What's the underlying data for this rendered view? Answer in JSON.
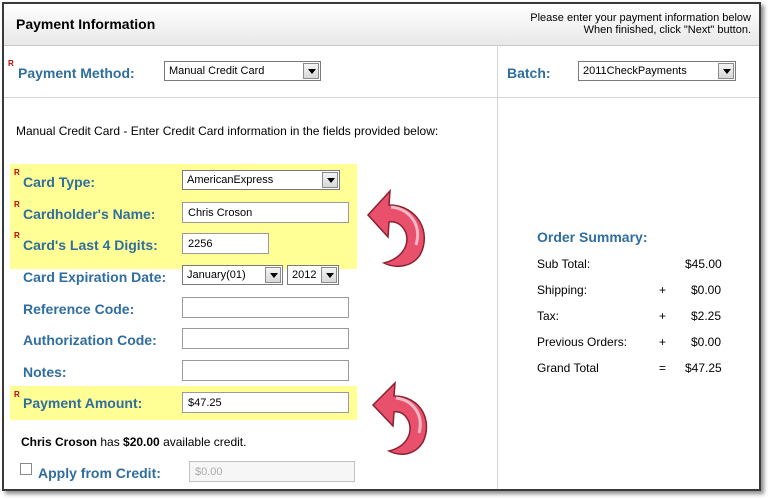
{
  "header": {
    "title": "Payment Information",
    "instruction_line1": "Please enter your payment information below",
    "instruction_line2": "When finished, click \"Next\" button."
  },
  "required_marker": "R",
  "payment_method": {
    "label": "Payment Method:",
    "selected": "Manual Credit Card"
  },
  "batch": {
    "label": "Batch:",
    "selected": "2011CheckPayments"
  },
  "intro_text": "Manual Credit Card - Enter Credit Card information in the fields provided below:",
  "card_type": {
    "label": "Card Type:",
    "selected": "AmericanExpress"
  },
  "cardholder": {
    "label": "Cardholder's Name:",
    "value": "Chris Croson"
  },
  "last4": {
    "label": "Card's Last 4 Digits:",
    "value": "2256"
  },
  "expiration": {
    "label": "Card Expiration Date:",
    "month": "January(01)",
    "year": "2012"
  },
  "reference": {
    "label": "Reference Code:",
    "value": ""
  },
  "authorization": {
    "label": "Authorization Code:",
    "value": ""
  },
  "notes": {
    "label": "Notes:",
    "value": ""
  },
  "payment_amount": {
    "label": "Payment Amount:",
    "value": "$47.25"
  },
  "credit": {
    "name": "Chris Croson",
    "has_text": " has ",
    "amount": "$20.00",
    "available_text": " available credit."
  },
  "apply_credit": {
    "label": "Apply from Credit:",
    "placeholder": "$0.00"
  },
  "order_summary": {
    "title": "Order Summary:",
    "rows": [
      {
        "label": "Sub Total:",
        "sign": "",
        "value": "$45.00"
      },
      {
        "label": "Shipping:",
        "sign": "+",
        "value": "$0.00"
      },
      {
        "label": "Tax:",
        "sign": "+",
        "value": "$2.25"
      },
      {
        "label": "Previous Orders:",
        "sign": "+",
        "value": "$0.00"
      },
      {
        "label": "Grand Total",
        "sign": "=",
        "value": "$47.25"
      }
    ]
  },
  "colors": {
    "label_blue": "#2f6e9e",
    "highlight": "#ffff96",
    "arrow_red": "#e0506a"
  }
}
